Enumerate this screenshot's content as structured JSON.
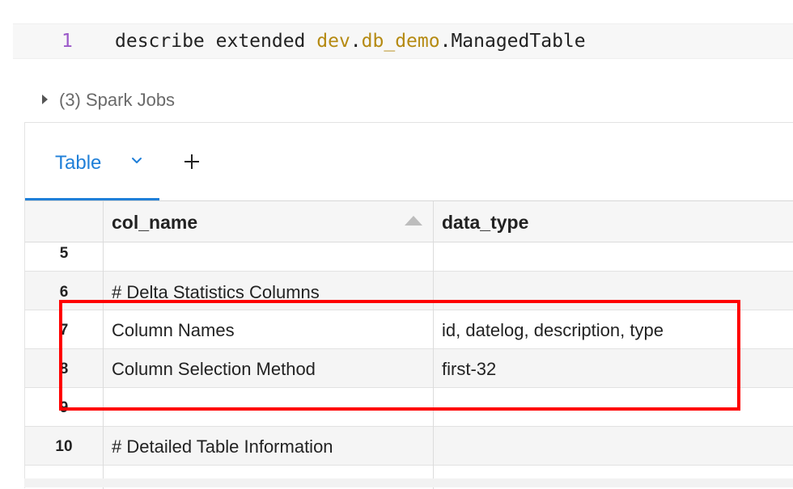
{
  "code": {
    "line_number": "1",
    "tokens": [
      {
        "text": "describe extended ",
        "kind": "kw"
      },
      {
        "text": "dev",
        "kind": "db"
      },
      {
        "text": ".",
        "kind": "plain"
      },
      {
        "text": "db_demo",
        "kind": "db"
      },
      {
        "text": ".ManagedTable",
        "kind": "plain"
      }
    ]
  },
  "spark_jobs": {
    "label": "(3) Spark Jobs"
  },
  "tabs": {
    "active_label": "Table"
  },
  "table": {
    "headers": {
      "col_a": "col_name",
      "col_b": "data_type"
    },
    "rows": [
      {
        "index": "5",
        "col_a": "",
        "col_b": ""
      },
      {
        "index": "6",
        "col_a": "# Delta Statistics Columns",
        "col_b": ""
      },
      {
        "index": "7",
        "col_a": "Column Names",
        "col_b": "id, datelog, description, type"
      },
      {
        "index": "8",
        "col_a": "Column Selection Method",
        "col_b": "first-32"
      },
      {
        "index": "9",
        "col_a": "",
        "col_b": ""
      },
      {
        "index": "10",
        "col_a": "# Detailed Table Information",
        "col_b": ""
      }
    ]
  },
  "colors": {
    "accent": "#1f7fd8",
    "highlight": "#ff0000",
    "db_token": "#b58a12",
    "line_number": "#9b59c9"
  }
}
